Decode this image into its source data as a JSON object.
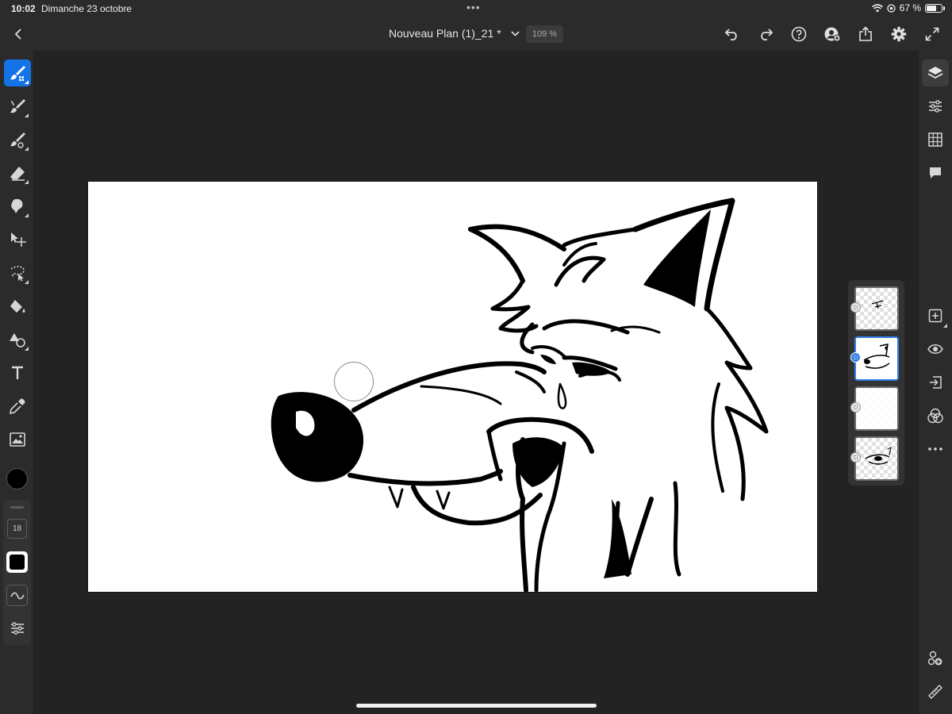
{
  "status_bar": {
    "time": "10:02",
    "date": "Dimanche 23 octobre",
    "battery_percent": "67 %",
    "battery_level": 0.67
  },
  "top_bar": {
    "document_title": "Nouveau Plan (1)_21 *",
    "zoom": "109 %"
  },
  "left_toolbar": {
    "tools": [
      {
        "name": "pixel-brush",
        "icon": "pixel-brush-icon",
        "active": true
      },
      {
        "name": "live-brush",
        "icon": "live-brush-icon"
      },
      {
        "name": "vector-brush",
        "icon": "vector-brush-icon"
      },
      {
        "name": "eraser",
        "icon": "eraser-icon"
      },
      {
        "name": "smudge",
        "icon": "smudge-icon"
      },
      {
        "name": "move",
        "icon": "move-icon"
      },
      {
        "name": "lasso",
        "icon": "lasso-icon"
      },
      {
        "name": "fill",
        "icon": "paint-bucket-icon"
      },
      {
        "name": "shapes",
        "icon": "shapes-icon"
      },
      {
        "name": "text",
        "icon": "text-icon"
      },
      {
        "name": "eyedropper",
        "icon": "eyedropper-icon"
      },
      {
        "name": "image",
        "icon": "image-icon"
      }
    ],
    "brush_color": "#000000",
    "brush_size": "18"
  },
  "right_rail": {
    "tools": [
      "layers-icon",
      "adjustments-icon",
      "grid-icon",
      "comment-icon",
      "add-layer-icon",
      "visibility-icon",
      "layer-import-icon",
      "blend-icon",
      "more-icon",
      "share-icon",
      "ruler-icon"
    ]
  },
  "layers_panel": {
    "layer_count": 4,
    "selected_index": 1
  },
  "colors": {
    "accent": "#1473e6",
    "panel": "#2b2b2b",
    "workspace": "#232323"
  }
}
